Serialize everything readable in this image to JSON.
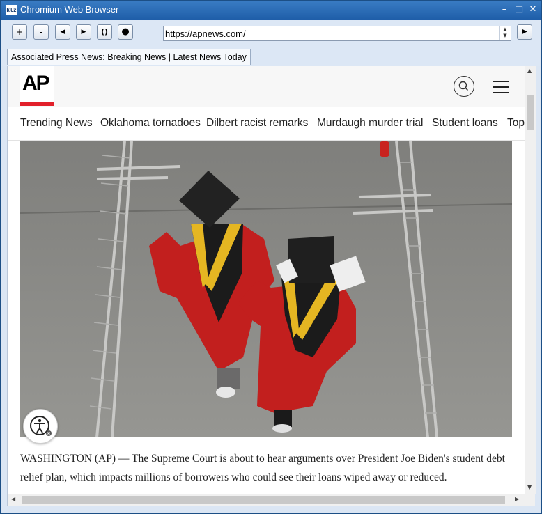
{
  "window": {
    "title": "Chromium Web Browser",
    "icon_text": "klz"
  },
  "toolbar": {
    "zoom_in": "+",
    "zoom_out": "-",
    "back": "◀",
    "forward": "▶",
    "reload": "()",
    "stop": "●",
    "go": "▶"
  },
  "address_bar": {
    "url": "https://apnews.com/"
  },
  "tab": {
    "title": "Associated Press News: Breaking News | Latest News Today"
  },
  "site": {
    "logo_text": "AP",
    "brand_color": "#e2202b",
    "nav": [
      "Trending News",
      "Oklahoma tornadoes",
      "Dilbert racist remarks",
      "Murdaugh murder trial",
      "Student loans",
      "Top"
    ],
    "article_text": "WASHINGTON (AP) — The Supreme Court is about to hear arguments over President Joe Biden's student debt relief plan, which impacts millions of borrowers who could see their loans wiped away or reduced."
  }
}
